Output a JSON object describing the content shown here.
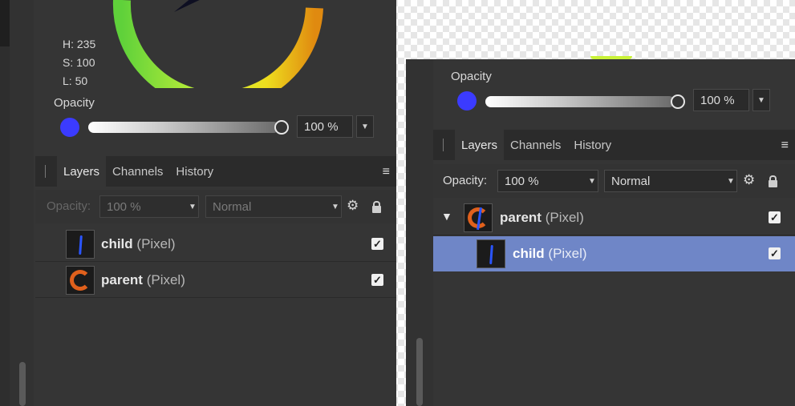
{
  "left_panel": {
    "hsl": {
      "h": "H: 235",
      "s": "S: 100",
      "l": "L: 50"
    },
    "opacity_label": "Opacity",
    "opacity_value": "100 %",
    "tabs": [
      "Layers",
      "Channels",
      "History"
    ],
    "toolbar": {
      "opacity_label": "Opacity:",
      "opacity_value": "100 %",
      "blend_mode": "Normal"
    },
    "layers": [
      {
        "name": "child",
        "kind": "(Pixel)"
      },
      {
        "name": "parent",
        "kind": "(Pixel)"
      }
    ]
  },
  "right_panel": {
    "opacity_label": "Opacity",
    "opacity_value": "100 %",
    "tabs": [
      "Layers",
      "Channels",
      "History"
    ],
    "toolbar": {
      "opacity_label": "Opacity:",
      "opacity_value": "100 %",
      "blend_mode": "Normal"
    },
    "layers": [
      {
        "name": "parent",
        "kind": "(Pixel)"
      },
      {
        "name": "child",
        "kind": "(Pixel)"
      }
    ]
  },
  "colors": {
    "swatch": "#3b3bff",
    "selected_row": "#6f86c7",
    "panel": "#353535"
  },
  "icons": [
    "gear-icon",
    "lock-icon",
    "menu-icon",
    "checkbox-icon",
    "disclosure-triangle-icon",
    "chevron-down-icon"
  ]
}
